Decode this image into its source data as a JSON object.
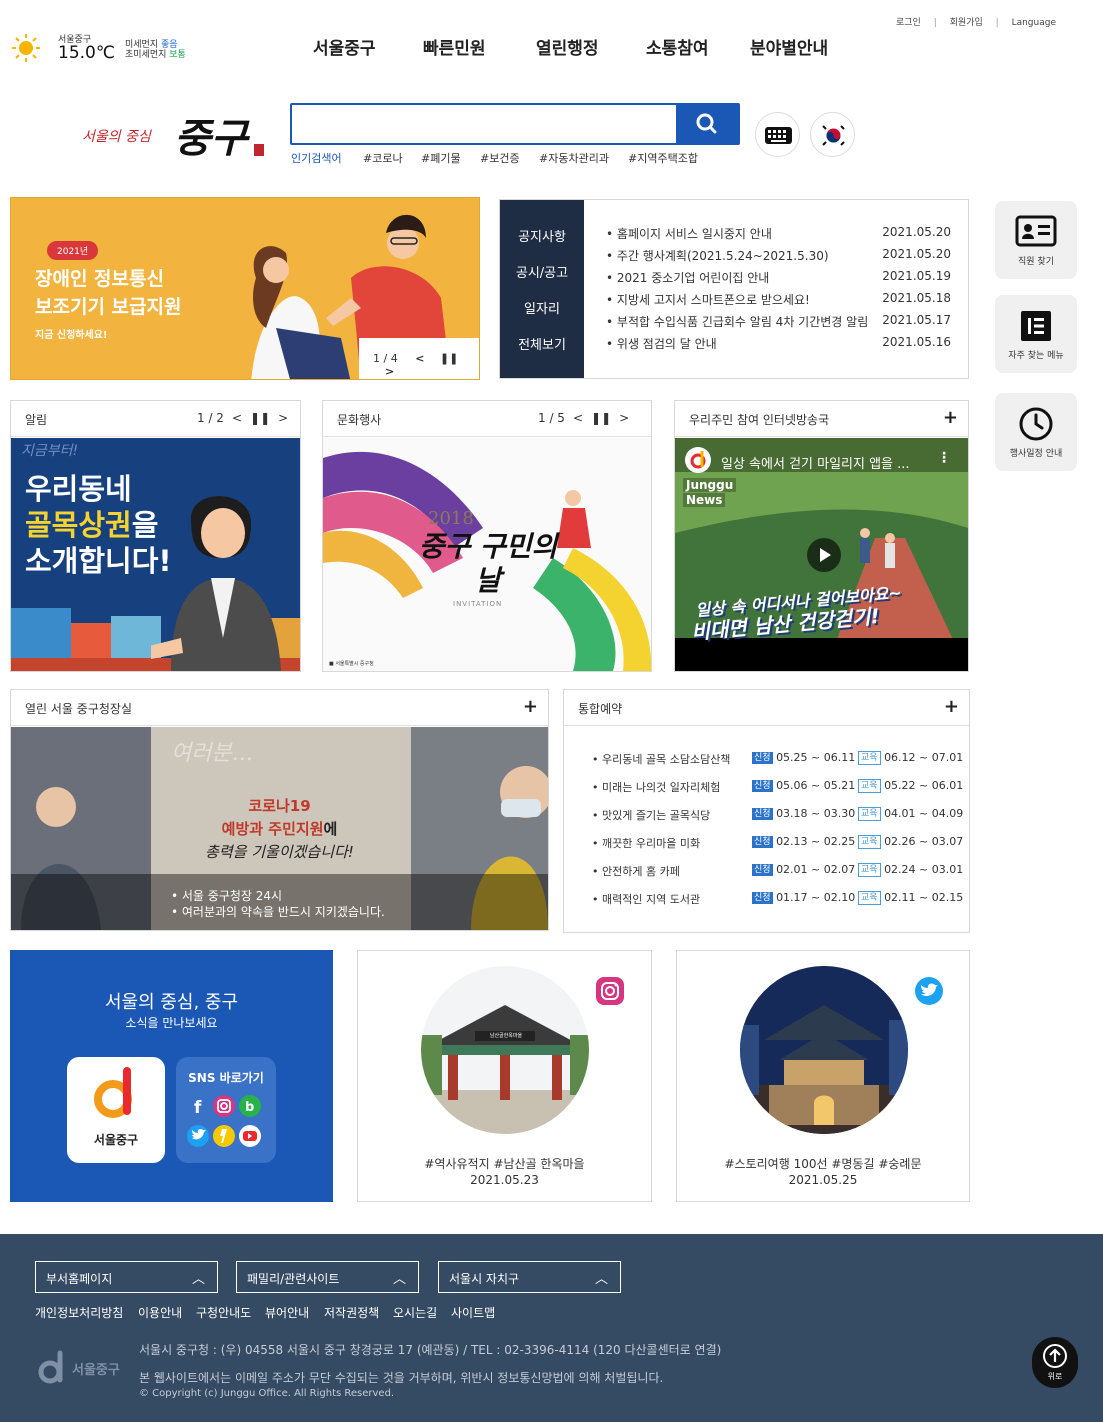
{
  "weather": {
    "district": "서울중구",
    "temp": "15.0℃",
    "dust_label": "미세먼지",
    "dust_value": "좋음",
    "fine_dust_label": "초미세먼지",
    "fine_dust_value": "보통"
  },
  "utility": {
    "login": "로그인",
    "join": "회원가입",
    "language": "Language"
  },
  "gnb": [
    "서울중구",
    "빠른민원",
    "열린행정",
    "소통참여",
    "분야별안내"
  ],
  "logo": {
    "slogan": "서울의 중심",
    "name": "중구"
  },
  "search": {
    "placeholder": "",
    "popular_label": "인기검색어",
    "tags": [
      "#코로나",
      "#폐기물",
      "#보건증",
      "#자동차관리과",
      "#지역주택조합"
    ]
  },
  "banner": {
    "badge": "2021년",
    "title1": "장애인 정보통신",
    "title2": "보조기기 보급지원",
    "sub": "지금 신청하세요!",
    "pager": "1 / 4"
  },
  "notice": {
    "tabs": [
      "공지사항",
      "공시/공고",
      "일자리",
      "전체보기"
    ],
    "items": [
      {
        "t": "홈페이지 서비스 일시중지 안내",
        "d": "2021.05.20"
      },
      {
        "t": "주간 행사계획(2021.5.24~2021.5.30)",
        "d": "2021.05.20"
      },
      {
        "t": "2021 중소기업 어린이집 안내",
        "d": "2021.05.19"
      },
      {
        "t": "지방세 고지서 스마트폰으로 받으세요!",
        "d": "2021.05.18"
      },
      {
        "t": "부적합 수입식품 긴급회수 알림 4차 기간변경 알림",
        "d": "2021.05.17"
      },
      {
        "t": "위생 점검의 달 안내",
        "d": "2021.05.16"
      }
    ]
  },
  "side": {
    "staff": "직원 찾기",
    "menu": "자주 찾는 메뉴",
    "schedule": "행사일정 안내"
  },
  "alim": {
    "title": "알림",
    "pager": "1 / 2",
    "img_line0": "지금부터!",
    "img_line1": "우리동네",
    "img_line2": "골목상권",
    "img_line2b": "을",
    "img_line3": "소개합니다!"
  },
  "culture": {
    "title": "문화행사",
    "pager": "1 / 5",
    "img_year": "2018",
    "img_main": "중구 구민의 날",
    "img_sub": "INVITATION",
    "img_caption": "■ 서울특별시 중구청"
  },
  "broadcast": {
    "title": "우리주민 참여 인터넷방송국",
    "video_title": "일상 속에서 걷기 마일리지 앱을 ...",
    "brand1": "Junggu",
    "brand2": "News",
    "overlay1": "일상 속 어디서나 걸어보아요~",
    "overlay2": "비대면 남산 건강걷기!"
  },
  "office": {
    "title": "열린 서울 중구청장실",
    "img_bg": "여러분...",
    "line1": "코로나19",
    "line2a": "예방과 주민지원",
    "line2b": "에",
    "line3": "총력을 기울이겠습니다!",
    "cap1": "• 서울 중구청장 24시",
    "cap2": "• 여러분과의 약속을 반드시 지키겠습니다."
  },
  "reserve": {
    "title": "통합예약",
    "apply": "신청",
    "edu": "교육",
    "items": [
      {
        "t": "우리동네 골목 소담소담산책",
        "a": "05.25 ~ 06.11",
        "e": "06.12 ~ 07.01"
      },
      {
        "t": "미래는 나의것 일자리체험",
        "a": "05.06 ~ 05.21",
        "e": "05.22 ~ 06.01"
      },
      {
        "t": "맛있게 즐기는 골목식당",
        "a": "03.18 ~ 03.30",
        "e": "04.01 ~ 04.09"
      },
      {
        "t": "깨끗한 우리마을 미화",
        "a": "02.13 ~ 02.25",
        "e": "02.26 ~ 03.07"
      },
      {
        "t": "안전하게 홈 카페",
        "a": "02.01 ~ 02.07",
        "e": "02.24 ~ 03.01"
      },
      {
        "t": "매력적인 지역 도서관",
        "a": "01.17 ~ 02.10",
        "e": "02.11 ~ 02.15"
      }
    ]
  },
  "sns": {
    "title": "서울의 중심, 중구",
    "sub": "소식을 만나보세요",
    "app_name": "서울중구",
    "go": "SNS 바로가기",
    "insta": {
      "tags": "#역사유적지 #남산골 한옥마을",
      "date": "2021.05.23",
      "sign": "남산골한옥마을"
    },
    "twitter": {
      "tags": "#스토리여행 100선 #명동길 #숭례문",
      "date": "2021.05.25"
    }
  },
  "footer": {
    "selects": [
      "부서홈페이지",
      "패밀리/관련사이트",
      "서울시 자치구"
    ],
    "links": [
      "개인정보처리방침",
      "이용안내",
      "구청안내도",
      "뷰어안내",
      "저작권정책",
      "오시는길",
      "사이트맵"
    ],
    "address": "서울시 중구청 : (우) 04558 서울시 중구 창경궁로 17 (예관동) / TEL : 02-3396-4114 (120 다산콜센터로 연결)",
    "notice": "본 웹사이트에서는 이메일 주소가 무단 수집되는 것을 거부하며, 위반시 정보통신망법에 의해 처벌됩니다.",
    "copyright": "© Copyright (c) Junggu Office. All Rights Reserved.",
    "logo": "서울중구",
    "top": "위로"
  },
  "colors": {
    "navy": "#1f2d44",
    "blue": "#1b57b4",
    "footer": "#354a63",
    "orange": "#f3b33f"
  }
}
